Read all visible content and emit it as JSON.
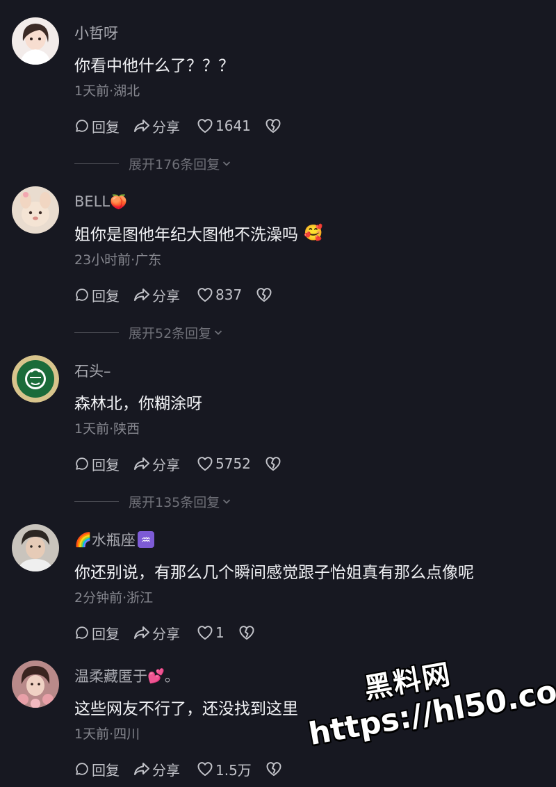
{
  "labels": {
    "reply": "回复",
    "share": "分享"
  },
  "comments": [
    {
      "username": "小哲呀",
      "text": "你看中他什么了？？？",
      "meta": "1天前·湖北",
      "likes": "1641",
      "expand": "展开176条回复"
    },
    {
      "username": "BELL",
      "username_emoji": "🍑",
      "text": "姐你是图他年纪大图他不洗澡吗",
      "text_emoji": "🥰",
      "meta": "23小时前·广东",
      "likes": "837",
      "expand": "展开52条回复"
    },
    {
      "username": "石头–",
      "text": "森林北，你糊涂呀",
      "meta": "1天前·陕西",
      "likes": "5752",
      "expand": "展开135条回复"
    },
    {
      "username": "水瓶座",
      "username_prefix_emoji": "🌈",
      "username_badge": "♒",
      "text": "你还别说，有那么几个瞬间感觉跟子怡姐真有那么点像呢",
      "meta": "2分钟前·浙江",
      "likes": "1"
    },
    {
      "username": "温柔藏匿于",
      "username_emoji": "💕",
      "username_suffix": "。",
      "text": "这些网友不行了，还没找到这里",
      "meta": "1天前·四川",
      "likes": "1.5万"
    }
  ],
  "watermark": {
    "title": "黑料网",
    "url": "https://hl50.co"
  },
  "colors": {
    "background": "#171821",
    "text_primary": "#f1f2f5",
    "text_secondary": "#a8a9b0",
    "text_muted": "#85868e",
    "starbucks_green": "#1b6b3a",
    "badge_purple": "#7d5bd6"
  }
}
